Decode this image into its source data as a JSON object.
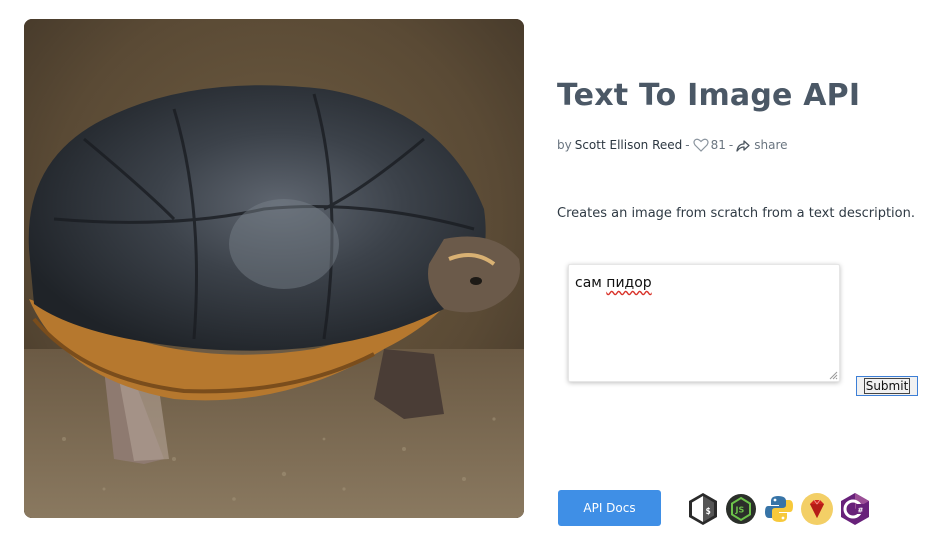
{
  "image": {
    "alt": "turtle-photo"
  },
  "header": {
    "title": "Text To Image API",
    "byline_prefix": "by",
    "author": "Scott Ellison Reed",
    "separator": "-",
    "like_count": "81",
    "share_label": "share"
  },
  "description": "Creates an image from scratch from a text description.",
  "form": {
    "prompt_word_1": "сам",
    "prompt_word_2": "пидор",
    "submit_label": "Submit"
  },
  "footer": {
    "docs_label": "API Docs",
    "languages": [
      "bash-icon",
      "nodejs-icon",
      "python-icon",
      "ruby-icon",
      "csharp-icon"
    ]
  },
  "colors": {
    "title": "#4b5866",
    "docs_button": "#3f8fe6",
    "submit_border": "#3d7fd6",
    "spellcheck": "#d9342b"
  }
}
